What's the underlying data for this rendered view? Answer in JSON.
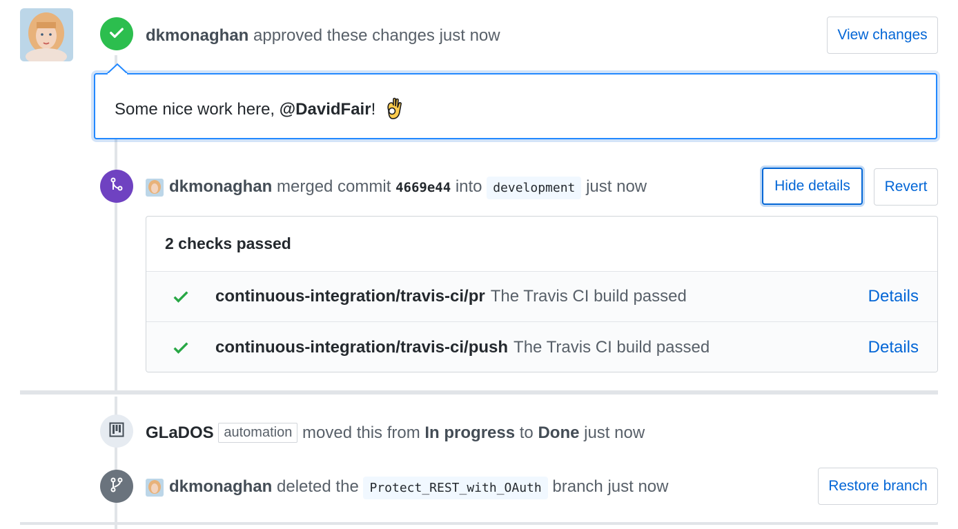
{
  "review": {
    "user": "dkmonaghan",
    "action": "approved these changes",
    "time": "just now",
    "view_changes_label": "View changes"
  },
  "comment": {
    "text_before": "Some nice work here, ",
    "mention": "@DavidFair",
    "text_after": "!",
    "emoji": "ok-hand-emoji"
  },
  "merge": {
    "user": "dkmonaghan",
    "action": "merged commit",
    "sha": "4669e44",
    "into": "into",
    "branch": "development",
    "time": "just now",
    "hide_details_label": "Hide details",
    "revert_label": "Revert"
  },
  "checks": {
    "header": "2 checks passed",
    "items": [
      {
        "context": "continuous-integration/travis-ci/pr",
        "description": "The Travis CI build passed",
        "link": "Details"
      },
      {
        "context": "continuous-integration/travis-ci/push",
        "description": "The Travis CI build passed",
        "link": "Details"
      }
    ]
  },
  "project_move": {
    "actor": "GLaDOS",
    "label": "automation",
    "text1": "moved this from",
    "from": "In progress",
    "to_word": "to",
    "to": "Done",
    "time": "just now"
  },
  "branch_delete": {
    "user": "dkmonaghan",
    "action": "deleted the",
    "branch": "Protect_REST_with_OAuth",
    "suffix": "branch just now",
    "restore_label": "Restore branch"
  },
  "colors": {
    "success": "#2cbe4e",
    "merged": "#6f42c1",
    "link": "#0366d6"
  }
}
